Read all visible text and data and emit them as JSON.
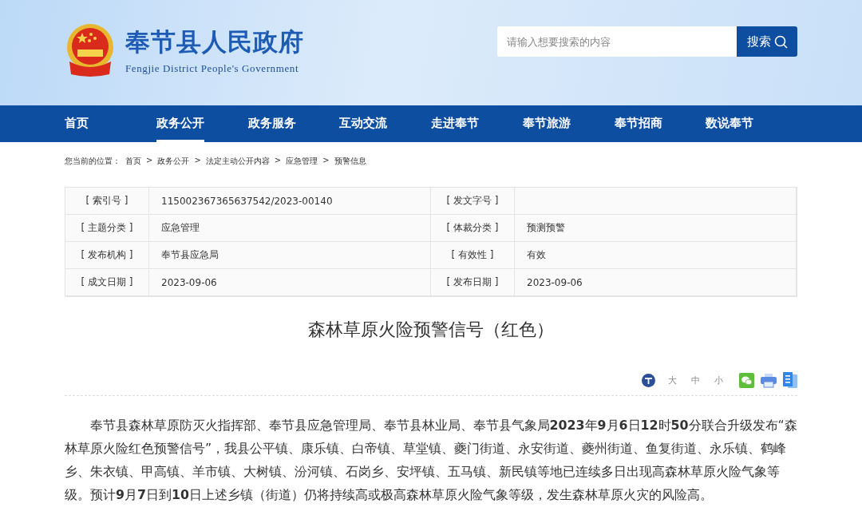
{
  "header": {
    "site_name": "奉节县人民政府",
    "site_name_en": "Fengjie District People's Government",
    "search": {
      "placeholder": "请输入想要搜索的内容",
      "button": "搜索"
    }
  },
  "nav": [
    {
      "label": "首页",
      "selected": false
    },
    {
      "label": "政务公开",
      "selected": true
    },
    {
      "label": "政务服务",
      "selected": false
    },
    {
      "label": "互动交流",
      "selected": false
    },
    {
      "label": "走进奉节",
      "selected": false
    },
    {
      "label": "奉节旅游",
      "selected": false
    },
    {
      "label": "奉节招商",
      "selected": false
    },
    {
      "label": "数说奉节",
      "selected": false
    }
  ],
  "breadcrumb": {
    "prefix": "您当前的位置：",
    "separator": ">",
    "items": [
      "首页",
      "政务公开",
      "法定主动公开内容",
      "应急管理",
      "预警信息"
    ]
  },
  "info_table": [
    [
      {
        "label": "[ 索引号 ]",
        "value": "115002367365637542/2023-00140"
      },
      {
        "label": "[ 发文字号 ]"
      }
    ],
    [
      {
        "label": "[ 主题分类 ]",
        "value": "应急管理"
      },
      {
        "label": "[ 体裁分类 ]",
        "value": "预测预警"
      }
    ],
    [
      {
        "label": "[ 发布机构 ]",
        "value": "奉节县应急局"
      },
      {
        "label": "[ 有效性 ]",
        "value": "有效"
      }
    ],
    [
      {
        "label": "[ 成文日期 ]",
        "value": "2023-09-06"
      },
      {
        "label": "[ 发布日期 ]",
        "value": "2023-09-06"
      }
    ]
  ],
  "article": {
    "title": "森林草原火险预警信号（红色）",
    "font_sizes": [
      "大",
      "中",
      "小"
    ],
    "paragraphs": [
      "奉节县森林草原防灭火指挥部、奉节县应急管理局、奉节县林业局、奉节县气象局**2023**年**9**月**6**日**12**时**50**分联合升级发布“森林草原火险红色预警信号”，我县公平镇、康乐镇、白帝镇、草堂镇、夔门街道、永安街道、夔州街道、鱼复街道、永乐镇、鹤峰乡、朱衣镇、甲高镇、羊市镇、大树镇、汾河镇、石岗乡、安坪镇、五马镇、新民镇等地已连续多日出现高森林草原火险气象等级。预计**9**月**7**日到**10**日上述乡镇（街道）仍将持续高或极高森林草原火险气象等级，发生森林草原火灾的风险高。"
    ]
  }
}
